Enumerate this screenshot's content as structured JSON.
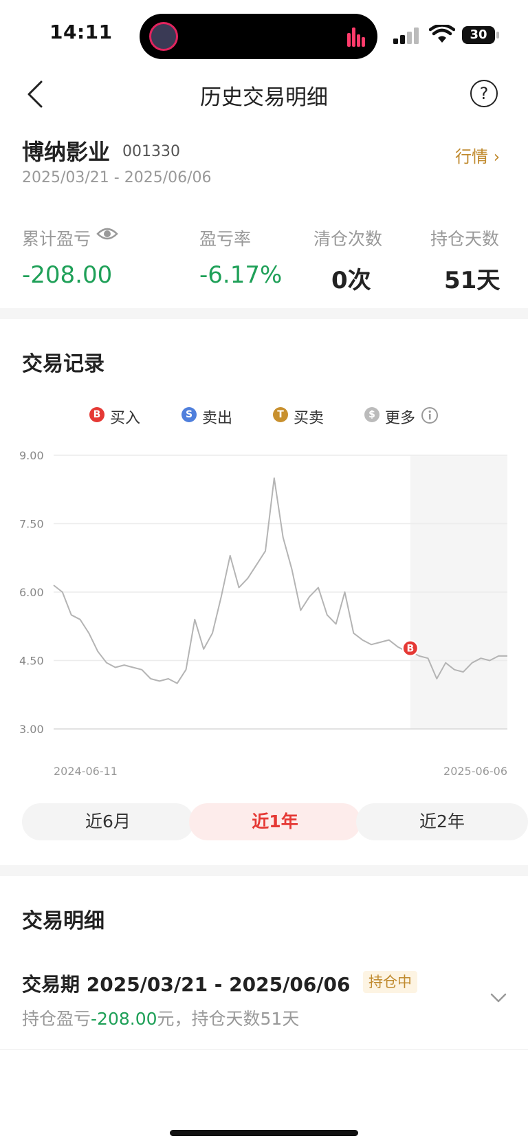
{
  "status_bar": {
    "time": "14:11",
    "battery": "30"
  },
  "nav": {
    "title": "历史交易明细",
    "help_glyph": "?",
    "back_icon": "chevron-left-icon",
    "help_icon": "question-circle-icon"
  },
  "stock": {
    "name": "博纳影业",
    "code": "001330",
    "quote_link": "行情 ›",
    "date_range": "2025/03/21 - 2025/06/06"
  },
  "stats": [
    {
      "label": "累计盈亏",
      "value": "-208.00",
      "color": "#1fa058"
    },
    {
      "label": "盈亏率",
      "value": "-6.17%",
      "color": "#1fa058"
    },
    {
      "label": "清仓次数",
      "value": "0次",
      "color": "#222222"
    },
    {
      "label": "持仓天数",
      "value": "51天",
      "color": "#222222"
    }
  ],
  "records": {
    "title": "交易记录",
    "legend": [
      {
        "badge": "B",
        "label": "买入",
        "color": "#e53935"
      },
      {
        "badge": "S",
        "label": "卖出",
        "color": "#4f7fdc"
      },
      {
        "badge": "T",
        "label": "买卖",
        "color": "#c8902e"
      },
      {
        "badge": "$",
        "label": "更多",
        "color": "#bbbbbb"
      }
    ]
  },
  "chart_data": {
    "type": "line",
    "yticks": [
      "9.00",
      "7.50",
      "6.00",
      "4.50",
      "3.00"
    ],
    "ylim": [
      3.0,
      9.0
    ],
    "x_start_label": "2024-06-11",
    "x_end_label": "2025-06-06",
    "x": [
      "2024-06-11",
      "2024-06-18",
      "2024-06-25",
      "2024-07-02",
      "2024-07-09",
      "2024-07-16",
      "2024-07-23",
      "2024-07-30",
      "2024-08-06",
      "2024-08-13",
      "2024-08-20",
      "2024-08-27",
      "2024-09-03",
      "2024-09-10",
      "2024-09-17",
      "2024-09-24",
      "2024-10-01",
      "2024-10-08",
      "2024-10-15",
      "2024-10-22",
      "2024-10-29",
      "2024-11-05",
      "2024-11-12",
      "2024-11-19",
      "2024-11-26",
      "2024-12-03",
      "2024-12-10",
      "2024-12-17",
      "2024-12-24",
      "2024-12-31",
      "2025-01-07",
      "2025-01-14",
      "2025-01-21",
      "2025-01-28",
      "2025-02-04",
      "2025-02-11",
      "2025-02-18",
      "2025-02-25",
      "2025-03-04",
      "2025-03-11",
      "2025-03-18",
      "2025-03-21",
      "2025-03-28",
      "2025-04-04",
      "2025-04-11",
      "2025-04-18",
      "2025-04-25",
      "2025-05-02",
      "2025-05-09",
      "2025-05-16",
      "2025-05-23",
      "2025-05-30",
      "2025-06-06"
    ],
    "series": [
      {
        "values": [
          6.15,
          6.0,
          5.5,
          5.4,
          5.1,
          4.7,
          4.45,
          4.35,
          4.4,
          4.35,
          4.3,
          4.1,
          4.05,
          4.1,
          4.0,
          4.3,
          5.4,
          4.75,
          5.1,
          5.9,
          6.8,
          6.1,
          6.3,
          6.6,
          6.9,
          8.5,
          7.2,
          6.5,
          5.6,
          5.9,
          6.1,
          5.5,
          5.3,
          6.0,
          5.1,
          4.95,
          4.85,
          4.9,
          4.95,
          4.8,
          4.7,
          4.7,
          4.6,
          4.55,
          4.1,
          4.45,
          4.3,
          4.25,
          4.45,
          4.55,
          4.5,
          4.6,
          4.6
        ]
      }
    ],
    "trades": [
      {
        "type": "B",
        "date": "2025-03-21",
        "price": 4.77
      }
    ],
    "holding_shade_from": "2025-03-21",
    "grid": true
  },
  "ranges": [
    {
      "label": "近6月",
      "active": false
    },
    {
      "label": "近1年",
      "active": true
    },
    {
      "label": "近2年",
      "active": false
    }
  ],
  "detail": {
    "title": "交易明细",
    "period": "交易期 2025/03/21 - 2025/06/06",
    "badge": "持仓中",
    "summary_prefix": "持仓盈亏",
    "summary_pnl": "-208.00",
    "summary_suffix": "元，持仓天数51天"
  }
}
